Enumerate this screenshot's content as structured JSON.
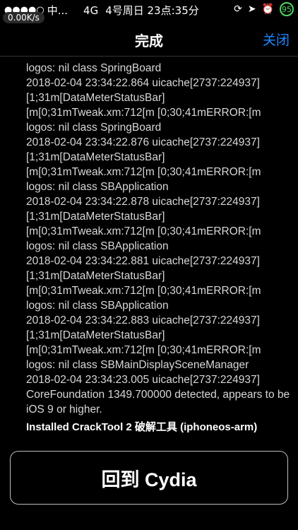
{
  "status_bar": {
    "signal": "●●●●○",
    "carrier": "中...",
    "network": "4G",
    "datetime": "4号周日 23点:35分",
    "battery": "95",
    "net_speed": "0.00K/s",
    "icons": [
      "rotation-lock-icon",
      "location-arrow-icon",
      "alarm-icon"
    ]
  },
  "nav": {
    "title": "完成",
    "close_label": "关闭"
  },
  "log_lines": [
    "logos: nil class SpringBoard",
    "2018-02-04 23:34:22.864 uicache[2737:224937]",
    "[1;31m[DataMeterStatusBar]",
    "[m[0;31mTweak.xm:712[m [0;30;41mERROR:[m",
    "logos: nil class SpringBoard",
    "2018-02-04 23:34:22.876 uicache[2737:224937]",
    "[1;31m[DataMeterStatusBar]",
    "[m[0;31mTweak.xm:712[m [0;30;41mERROR:[m",
    "logos: nil class SBApplication",
    "2018-02-04 23:34:22.878 uicache[2737:224937]",
    "[1;31m[DataMeterStatusBar]",
    "[m[0;31mTweak.xm:712[m [0;30;41mERROR:[m",
    "logos: nil class SBApplication",
    "2018-02-04 23:34:22.881 uicache[2737:224937]",
    "[1;31m[DataMeterStatusBar]",
    "[m[0;31mTweak.xm:712[m [0;30;41mERROR:[m",
    "logos: nil class SBApplication",
    "2018-02-04 23:34:22.883 uicache[2737:224937]",
    "[1;31m[DataMeterStatusBar]",
    "[m[0;31mTweak.xm:712[m [0;30;41mERROR:[m",
    "logos: nil class SBMainDisplaySceneManager",
    "2018-02-04 23:34:23.005 uicache[2737:224937]",
    "CoreFoundation 1349.700000 detected, appears to be iOS 9 or higher."
  ],
  "final_message": "Installed CrackTool 2 破解工具 (iphoneos-arm)",
  "return_button_label": "回到 Cydia",
  "colors": {
    "background": "#000000",
    "accent": "#1e88ff",
    "battery": "#4cd964"
  }
}
